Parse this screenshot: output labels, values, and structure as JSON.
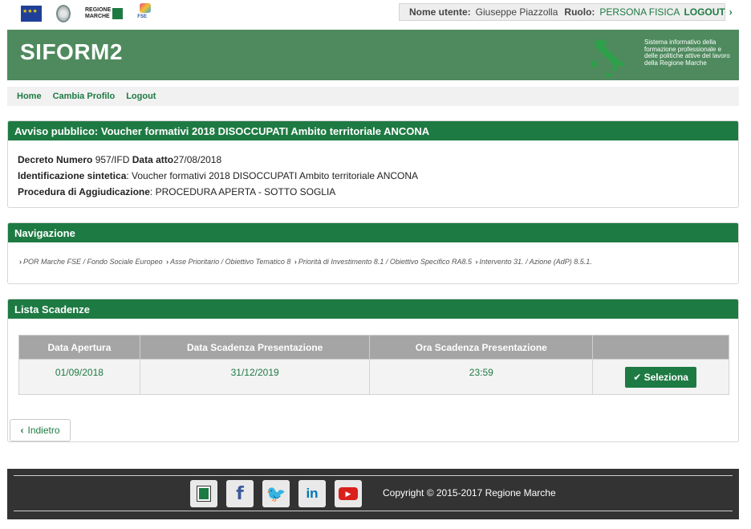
{
  "topbar": {
    "user_label": "Nome utente:",
    "user_value": "Giuseppe Piazzolla",
    "role_label": "Ruolo:",
    "role_value": "PERSONA FISICA",
    "logout": "LOGOUT"
  },
  "logos": {
    "regione_text": "REGIONE\nMARCHE",
    "fse_text": "FSE"
  },
  "header": {
    "title": "SIFORM2",
    "description": "Sistema informativo della formazione professionale e delle politiche attive del lavoro della Regione Marche"
  },
  "nav": {
    "items": [
      "Home",
      "Cambia Profilo",
      "Logout"
    ]
  },
  "avviso": {
    "title": "Avviso pubblico: Voucher formativi 2018 DISOCCUPATI Ambito territoriale ANCONA",
    "decreto_label": "Decreto Numero",
    "decreto_value": "957/IFD",
    "data_atto_label": "Data atto",
    "data_atto_value": "27/08/2018",
    "ident_label": "Identificazione sintetica",
    "ident_value": ": Voucher formativi 2018 DISOCCUPATI Ambito territoriale ANCONA",
    "proc_label": "Procedura di Aggiudicazione",
    "proc_value": ": PROCEDURA APERTA - SOTTO SOGLIA"
  },
  "navigazione": {
    "title": "Navigazione",
    "crumbs": [
      "POR Marche FSE / Fondo Sociale Europeo",
      "Asse Prioritario / Obiettivo Tematico 8",
      "Priorità di Investimento 8.1 / Obiettivo Specifico RA8.5",
      "Intervento 31. / Azione (AdP) 8.5.1."
    ]
  },
  "scadenze": {
    "title": "Lista Scadenze",
    "headers": [
      "Data Apertura",
      "Data Scadenza Presentazione",
      "Ora Scadenza Presentazione",
      ""
    ],
    "row": {
      "apertura": "01/09/2018",
      "scadenza": "31/12/2019",
      "ora": "23:59",
      "button": "Seleziona"
    },
    "back_button": "Indietro"
  },
  "footer": {
    "copyright": "Copyright © 2015-2017 Regione Marche",
    "social": [
      "regione-marche-icon",
      "facebook-icon",
      "twitter-icon",
      "linkedin-icon",
      "youtube-icon"
    ]
  }
}
